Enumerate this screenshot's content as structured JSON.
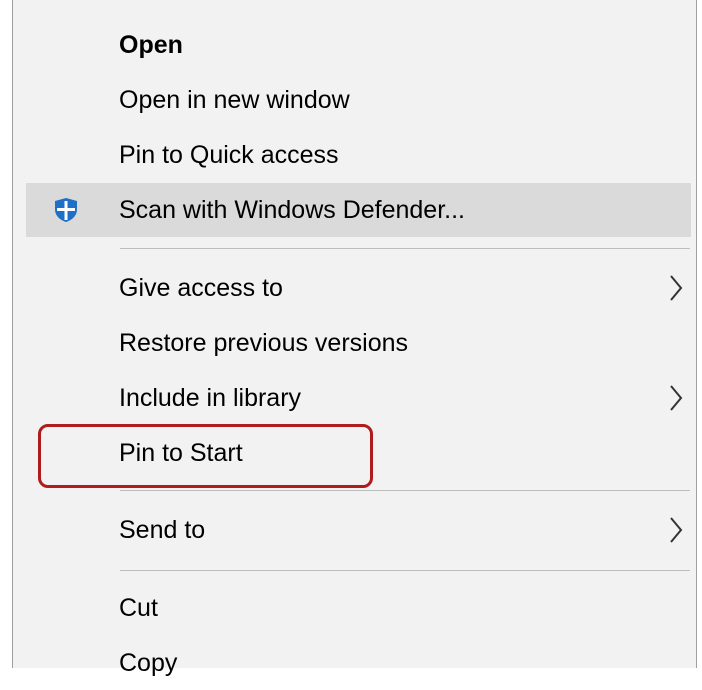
{
  "menu": {
    "items": [
      {
        "label": "Open",
        "bold": true
      },
      {
        "label": "Open in new window"
      },
      {
        "label": "Pin to Quick access"
      },
      {
        "label": "Scan with Windows Defender..."
      },
      {
        "label": "Give access to"
      },
      {
        "label": "Restore previous versions"
      },
      {
        "label": "Include in library"
      },
      {
        "label": "Pin to Start"
      },
      {
        "label": "Send to"
      },
      {
        "label": "Cut"
      },
      {
        "label": "Copy"
      }
    ]
  },
  "icons": {
    "defender": "windows-defender-shield-icon",
    "submenu": "chevron-right-icon"
  },
  "colors": {
    "menu_background": "#f2f2f2",
    "hover_background": "#dadada",
    "defender_blue": "#1f6fc9",
    "annotation_red": "#b01c1c"
  }
}
